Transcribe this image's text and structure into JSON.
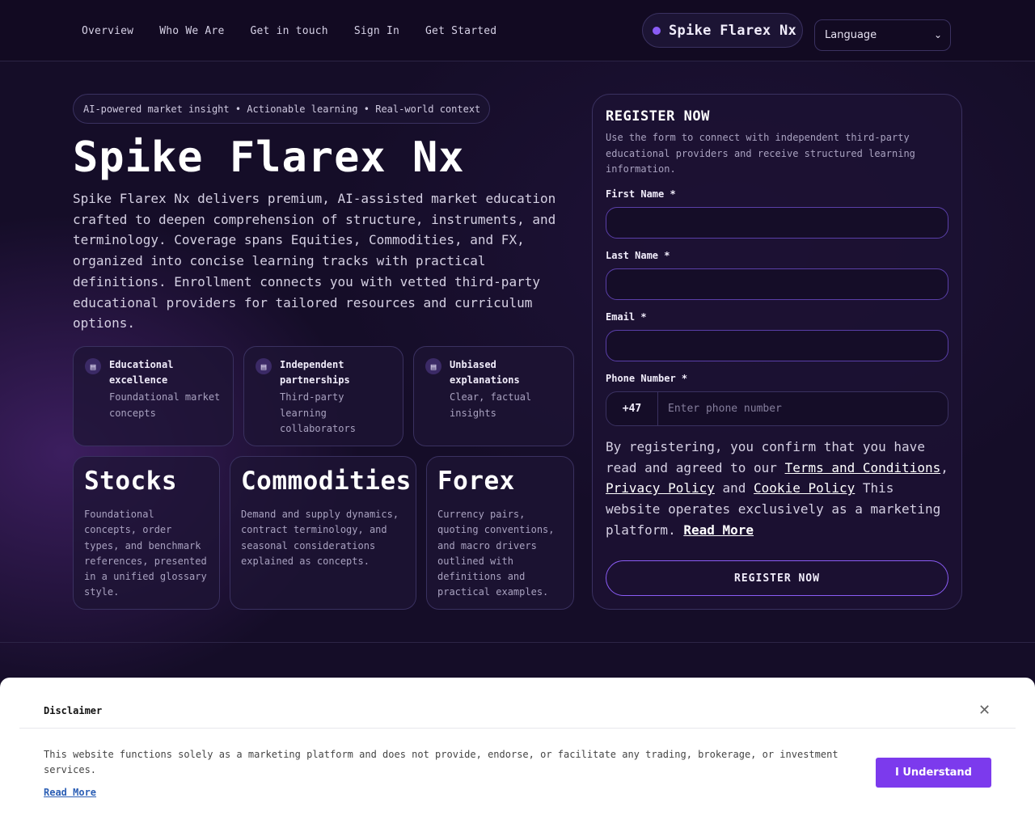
{
  "nav": {
    "items": [
      "Overview",
      "Who We Are",
      "Get in touch",
      "Sign In",
      "Get Started"
    ]
  },
  "brand": {
    "name": "Spike Flarex Nx",
    "accent": "#8a5cf5"
  },
  "language": {
    "label": "Language"
  },
  "hero": {
    "tagline": "AI-powered market insight • Actionable learning • Real-world context",
    "title": "Spike Flarex Nx",
    "description": "Spike Flarex Nx delivers premium, AI-assisted market education crafted to deepen comprehension of structure, instruments, and terminology. Coverage spans Equities, Commodities, and FX, organized into concise learning tracks with practical definitions. Enrollment connects you with vetted third-party educational providers for tailored resources and curriculum options."
  },
  "features": [
    {
      "title": "Educational excellence",
      "subtitle": "Foundational market concepts",
      "icon": "book-icon"
    },
    {
      "title": "Independent partnerships",
      "subtitle": "Third-party learning collaborators",
      "icon": "book-icon"
    },
    {
      "title": "Unbiased explanations",
      "subtitle": "Clear, factual insights",
      "icon": "book-icon"
    }
  ],
  "markets": [
    {
      "title": "Stocks",
      "description": [
        "Foundational",
        "concepts, order",
        "types, and benchmark",
        "references, presented",
        "in a unified glossary",
        "style."
      ]
    },
    {
      "title": "Commodities",
      "description": [
        "Demand and supply dynamics,",
        "contract terminology, and",
        "seasonal considerations",
        "explained as concepts."
      ]
    },
    {
      "title": "Forex",
      "description": [
        "Currency pairs,",
        "quoting conventions,",
        "and macro drivers",
        "outlined with",
        "definitions and",
        "practical examples."
      ]
    }
  ],
  "form": {
    "title": "REGISTER NOW",
    "subtitle": "Use the form to connect with independent third-party educational providers and receive structured learning information.",
    "first_name_label": "First Name *",
    "last_name_label": "Last Name *",
    "email_label": "Email *",
    "phone_label": "Phone Number *",
    "phone_code": "+47",
    "phone_placeholder": "Enter phone number",
    "consent_prefix": "By registering, you confirm that you have read and agreed to our ",
    "terms_link": "Terms and Conditions",
    "comma": ",",
    "privacy_link": "Privacy Policy",
    "and_text": " and ",
    "cookie_link": "Cookie Policy",
    "consent_suffix": " This website operates exclusively as a marketing platform. ",
    "read_more": "Read More",
    "submit": "REGISTER NOW"
  },
  "disclaimer": {
    "title": "Disclaimer",
    "text": "This website functions solely as a marketing platform and does not provide, endorse, or facilitate any trading, brokerage, or investment services.",
    "read_more": "Read More",
    "button": "I Understand",
    "button_color": "#7c3aed"
  }
}
